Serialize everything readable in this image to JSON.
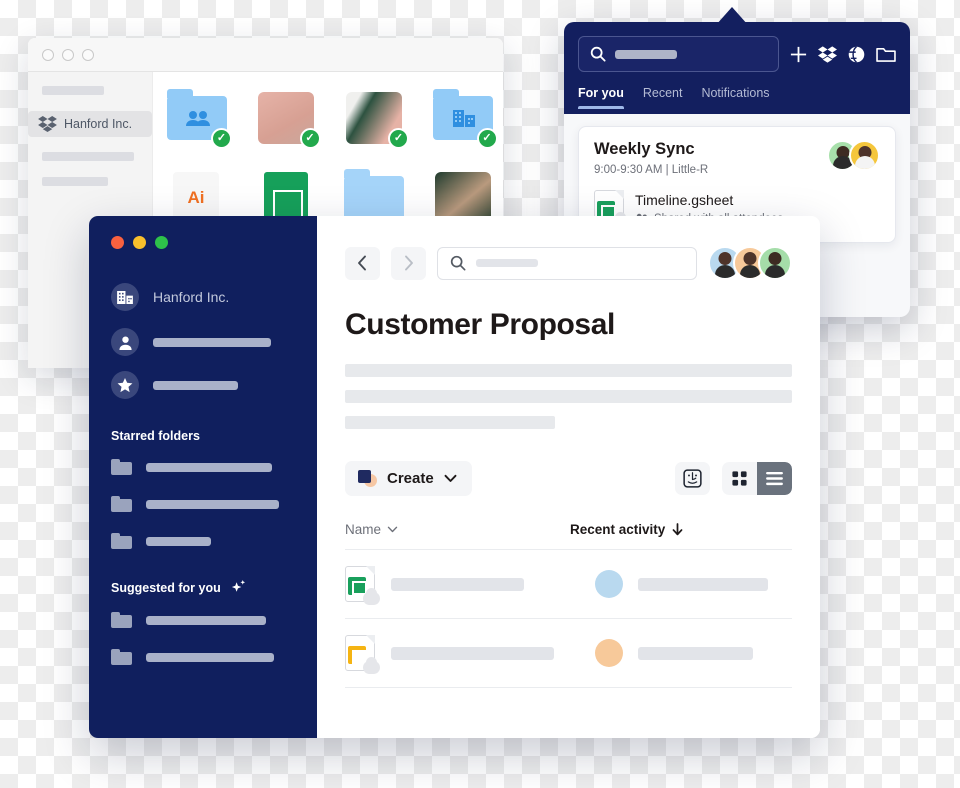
{
  "background_window": {
    "sidebar": {
      "org_name": "Hanford Inc.",
      "brand_icon": "dropbox-logo-icon"
    },
    "grid_items": [
      {
        "type": "folder-shared",
        "icon": "shared-folder-icon",
        "badge": "sync-check-badge"
      },
      {
        "type": "photo",
        "icon": "photo-shirt-thumbnail",
        "badge": "sync-check-badge"
      },
      {
        "type": "photo",
        "icon": "photo-plant-thumbnail",
        "badge": "sync-check-badge"
      },
      {
        "type": "folder-team",
        "icon": "team-folder-icon",
        "badge": "sync-check-badge"
      },
      {
        "type": "illustrator",
        "label": "Ai",
        "icon": "illustrator-file-icon"
      },
      {
        "type": "sheet",
        "icon": "spreadsheet-file-icon"
      },
      {
        "type": "folder",
        "icon": "folder-icon"
      },
      {
        "type": "photo",
        "icon": "photo-dark-thumbnail"
      }
    ]
  },
  "popover": {
    "search": {
      "placeholder": "",
      "icon": "search-icon"
    },
    "actions": [
      {
        "name": "add-icon",
        "glyph": "+"
      },
      {
        "name": "dropbox-logo-icon",
        "glyph": "layers"
      },
      {
        "name": "globe-icon",
        "glyph": "globe"
      },
      {
        "name": "folder-icon",
        "glyph": "folder"
      }
    ],
    "tabs": [
      {
        "label": "For you",
        "active": true
      },
      {
        "label": "Recent",
        "active": false
      },
      {
        "label": "Notifications",
        "active": false
      }
    ],
    "meeting": {
      "title": "Weekly Sync",
      "time": "9:00-9:30 AM | Little-R",
      "file_name": "Timeline.gsheet",
      "file_icon": "spreadsheet-file-icon",
      "shared_text": "Shared with all attendees",
      "shared_icon": "people-icon"
    }
  },
  "main_window": {
    "traffic_lights": [
      {
        "name": "close-button",
        "color": "#f9613f"
      },
      {
        "name": "minimize-button",
        "color": "#f9bf2c"
      },
      {
        "name": "maximize-button",
        "color": "#2ec14a"
      }
    ],
    "sidebar": {
      "org_name": "Hanford Inc.",
      "org_icon": "building-icon",
      "nav_items": [
        {
          "icon": "person-icon",
          "label_width": 118
        },
        {
          "icon": "star-icon",
          "label_width": 85
        }
      ],
      "starred_header": "Starred folders",
      "starred_folders": [
        {
          "icon": "folder-icon",
          "label_width": 126
        },
        {
          "icon": "folder-icon",
          "label_width": 133
        },
        {
          "icon": "folder-icon",
          "label_width": 65
        }
      ],
      "suggested_header": "Suggested for you",
      "suggested_icon": "sparkle-icon",
      "suggested_folders": [
        {
          "icon": "folder-icon",
          "label_width": 120
        },
        {
          "icon": "folder-icon",
          "label_width": 128
        }
      ]
    },
    "topbar": {
      "back_icon": "chevron-left-icon",
      "forward_icon": "chevron-right-icon",
      "search": {
        "placeholder": "",
        "icon": "search-icon"
      },
      "avatars": [
        {
          "name": "avatar-1",
          "color": "#b9d9ef"
        },
        {
          "name": "avatar-2",
          "color": "#f7c99a"
        },
        {
          "name": "avatar-3",
          "color": "#a5dda9"
        }
      ]
    },
    "page_title": "Customer Proposal",
    "body_bars": [
      100,
      100,
      47
    ],
    "toolbar": {
      "create_label": "Create",
      "create_chevron": "chevron-down-icon",
      "finder_icon": "finder-icon",
      "grid_view_icon": "grid-view-icon",
      "list_view_icon": "list-view-icon",
      "active_view": "list"
    },
    "columns": {
      "name_label": "Name",
      "name_sort_icon": "chevron-down-icon",
      "activity_label": "Recent activity",
      "activity_sort_icon": "arrow-down-icon"
    },
    "rows": [
      {
        "file_icon": "spreadsheet-file-icon",
        "file_icon_color": "#19a05c",
        "cloud_badge": "cloud-sync-icon",
        "name_width": 133,
        "avatar_color": "#b9d9ef",
        "activity_width": 130
      },
      {
        "file_icon": "presentation-file-icon",
        "file_icon_color": "#f5b413",
        "cloud_badge": "cloud-sync-icon",
        "name_width": 163,
        "avatar_color": "#f7c99a",
        "activity_width": 115
      }
    ]
  }
}
